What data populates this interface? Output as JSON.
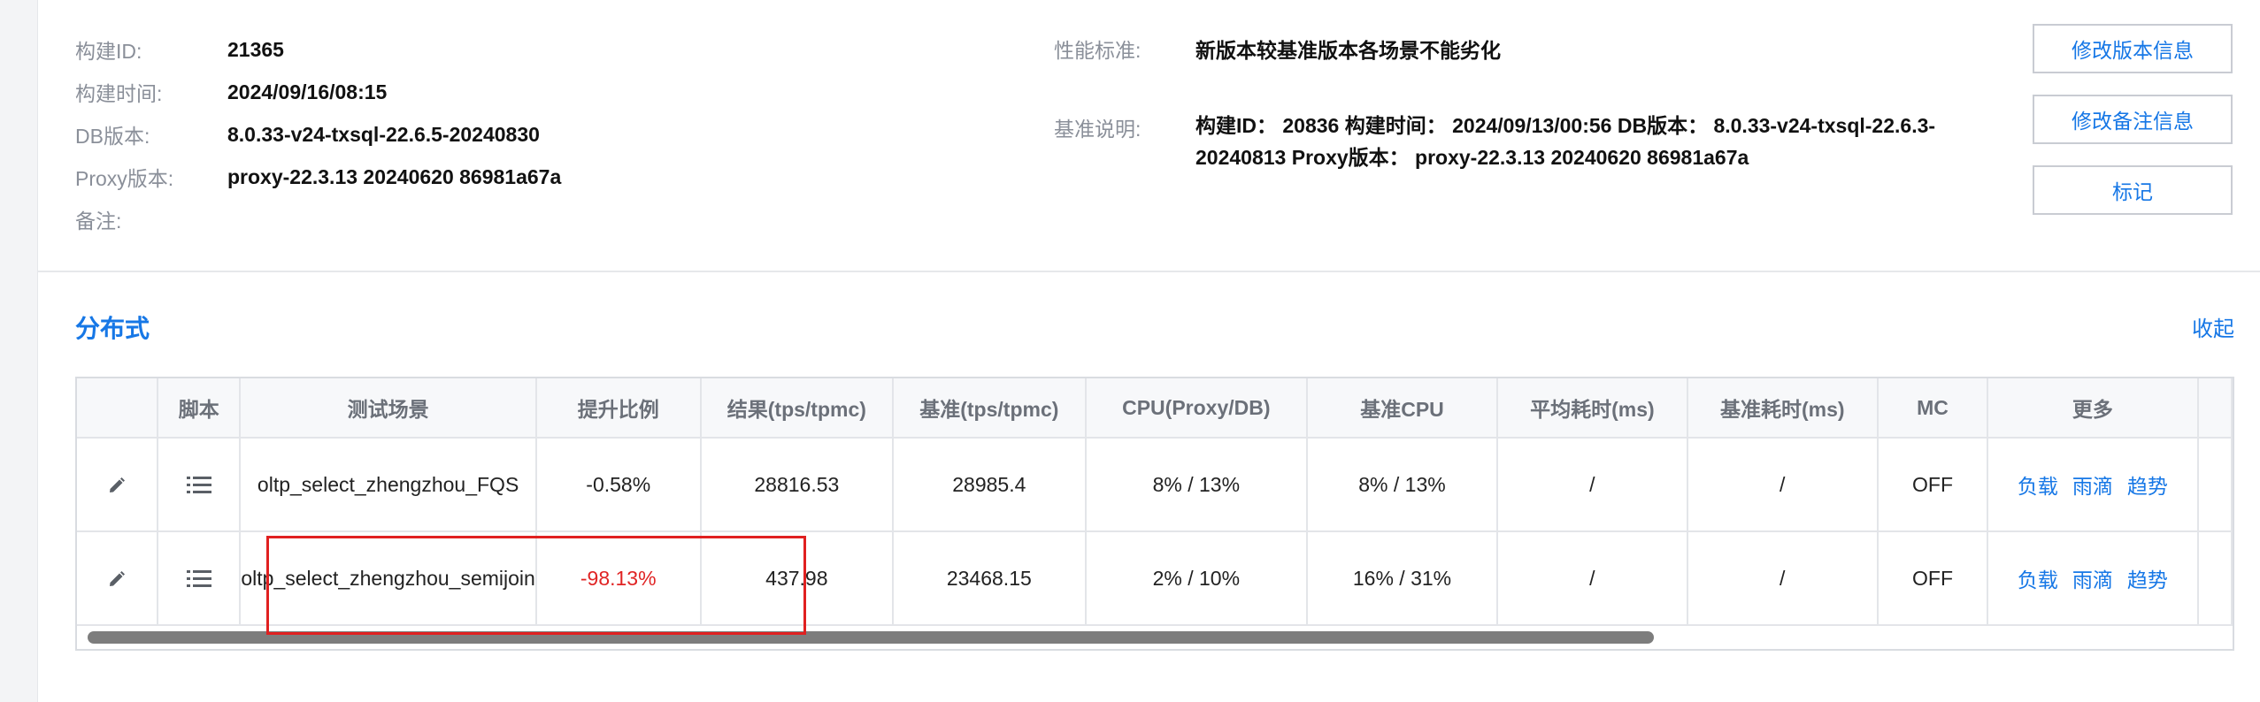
{
  "info": {
    "build_id_label": "构建ID:",
    "build_id": "21365",
    "build_time_label": "构建时间:",
    "build_time": "2024/09/16/08:15",
    "db_version_label": "DB版本:",
    "db_version": "8.0.33-v24-txsql-22.6.5-20240830",
    "proxy_version_label": "Proxy版本:",
    "proxy_version": "proxy-22.3.13 20240620 86981a67a",
    "remark_label": "备注:",
    "perf_standard_label": "性能标准:",
    "perf_standard": "新版本较基准版本各场景不能劣化",
    "baseline_label": "基准说明:",
    "baseline_desc": "构建ID： 20836 构建时间： 2024/09/13/00:56 DB版本： 8.0.33-v24-txsql-22.6.3-20240813 Proxy版本： proxy-22.3.13 20240620 86981a67a"
  },
  "actions": {
    "edit_version": "修改版本信息",
    "edit_remark": "修改备注信息",
    "mark": "标记"
  },
  "section": {
    "title": "分布式",
    "collapse": "收起"
  },
  "table": {
    "headers": [
      "",
      "脚本",
      "测试场景",
      "提升比例",
      "结果(tps/tpmc)",
      "基准(tps/tpmc)",
      "CPU(Proxy/DB)",
      "基准CPU",
      "平均耗时(ms)",
      "基准耗时(ms)",
      "MC",
      "更多"
    ],
    "rows": [
      {
        "scene": "oltp_select_zhengzhou_FQS",
        "ratio": "-0.58%",
        "result": "28816.53",
        "baseline": "28985.4",
        "cpu": "8% / 13%",
        "base_cpu": "8% / 13%",
        "avg_latency": "/",
        "base_latency": "/",
        "mc": "OFF",
        "links": [
          "负载",
          "雨滴",
          "趋势"
        ]
      },
      {
        "scene": "oltp_select_zhengzhou_semijoin",
        "ratio": "-98.13%",
        "result": "437.98",
        "baseline": "23468.15",
        "cpu": "2% / 10%",
        "base_cpu": "16% / 31%",
        "avg_latency": "/",
        "base_latency": "/",
        "mc": "OFF",
        "links": [
          "负载",
          "雨滴",
          "趋势"
        ]
      }
    ]
  },
  "colors": {
    "accent": "#1677e6",
    "negative": "#e02424",
    "highlight": "#e02020"
  }
}
